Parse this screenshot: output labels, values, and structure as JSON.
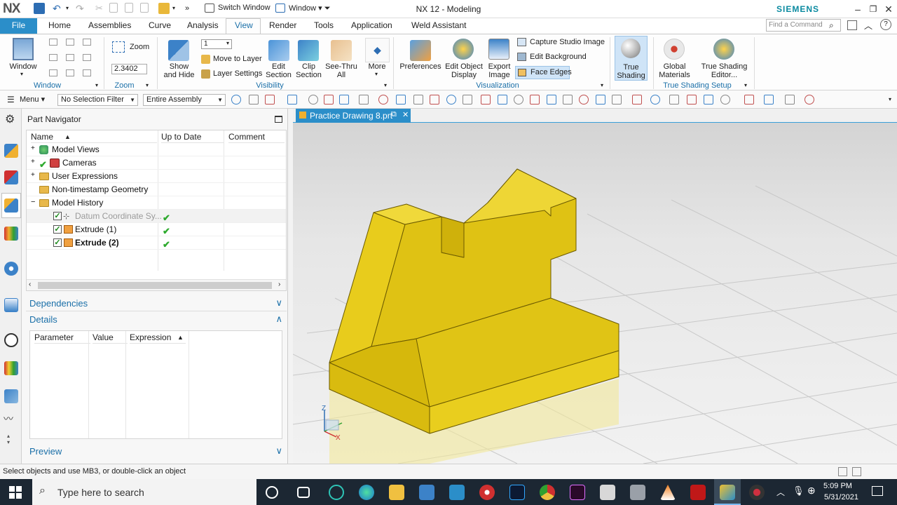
{
  "titlebar": {
    "app_logo": "NX",
    "switch_window": "Switch Window",
    "window_menu": "Window",
    "title": "NX 12 - Modeling",
    "brand": "SIEMENS"
  },
  "menu": {
    "file": "File",
    "tabs": [
      "Home",
      "Assemblies",
      "Curve",
      "Analysis",
      "View",
      "Render",
      "Tools",
      "Application",
      "Weld Assistant"
    ],
    "active_tab": "View",
    "find_command_placeholder": "Find a Command"
  },
  "ribbon": {
    "window": {
      "label": "Window",
      "group": "Window"
    },
    "zoom": {
      "label": "Zoom",
      "value": "2.3402",
      "group": "Zoom"
    },
    "visibility": {
      "layer_value": "1",
      "show_and_hide": "Show\nand Hide",
      "move_to_layer": "Move to Layer",
      "layer_settings": "Layer Settings",
      "edit_section": "Edit\nSection",
      "clip_section": "Clip\nSection",
      "see_thru_all": "See-Thru\nAll",
      "more": "More",
      "group": "Visibility"
    },
    "visualization": {
      "preferences": "Preferences",
      "edit_object_display": "Edit Object\nDisplay",
      "export_image": "Export\nImage",
      "capture_studio_image": "Capture Studio Image",
      "edit_background": "Edit Background",
      "face_edges": "Face Edges",
      "group": "Visualization"
    },
    "true_shading": {
      "label": "True\nShading"
    },
    "true_shading_setup": {
      "global_materials": "Global\nMaterials",
      "true_shading_editor": "True Shading\nEditor...",
      "group": "True Shading Setup"
    }
  },
  "selection_bar": {
    "menu": "Menu",
    "filter": "No Selection Filter",
    "scope": "Entire Assembly"
  },
  "part_navigator": {
    "title": "Part Navigator",
    "columns": [
      "Name",
      "Up to Date",
      "Comment"
    ],
    "rows": [
      {
        "name": "Model Views"
      },
      {
        "name": "Cameras"
      },
      {
        "name": "User Expressions"
      },
      {
        "name": "Non-timestamp Geometry"
      },
      {
        "name": "Model History"
      },
      {
        "name": "Datum Coordinate Sy..."
      },
      {
        "name": "Extrude (1)"
      },
      {
        "name": "Extrude (2)"
      }
    ],
    "dependencies": "Dependencies",
    "details": "Details",
    "details_columns": [
      "Parameter",
      "Value",
      "Expression"
    ],
    "preview": "Preview"
  },
  "graphics": {
    "tab_title": "Practice Drawing 8.prt",
    "axis_x": "X",
    "axis_z": "Z",
    "model_color": "#e2c214"
  },
  "status": {
    "message": "Select objects and use MB3, or double-click an object"
  },
  "taskbar": {
    "search_placeholder": "Type here to search",
    "time": "5:09 PM",
    "date": "5/31/2021"
  }
}
